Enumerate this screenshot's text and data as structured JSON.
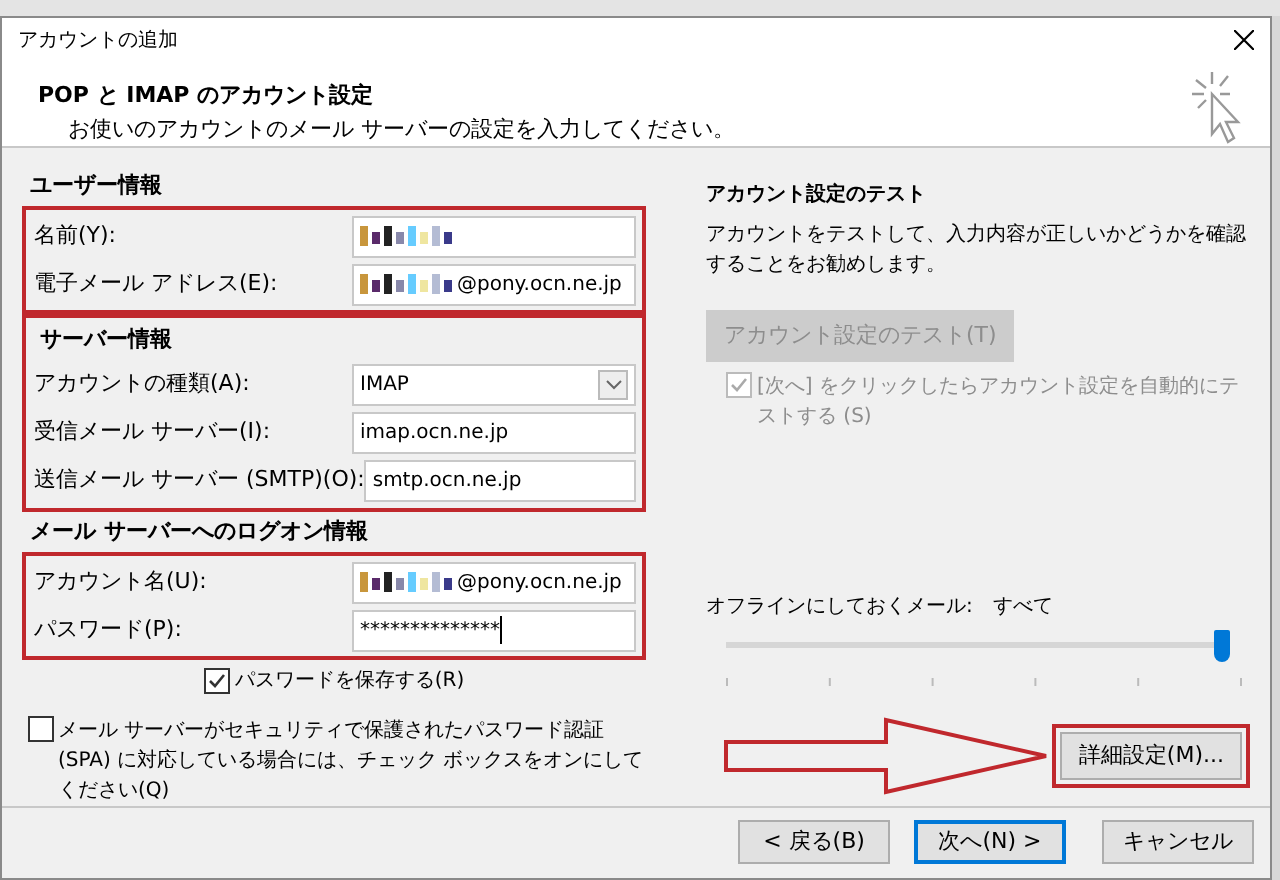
{
  "window": {
    "title": "アカウントの追加"
  },
  "header": {
    "title": "POP と IMAP のアカウント設定",
    "subtitle": "お使いのアカウントのメール サーバーの設定を入力してください。"
  },
  "sections": [
    {
      "heading": "ユーザー情報",
      "kind": "framed-fields",
      "fields": [
        {
          "label": "名前(Y):",
          "kind": "text",
          "redacted": true
        },
        {
          "label": "電子メール アドレス(E):",
          "kind": "text",
          "redacted": true,
          "value": "@pony.ocn.ne.jp"
        }
      ]
    },
    {
      "heading": "サーバー情報",
      "kind": "framed-section",
      "fields": [
        {
          "label": "アカウントの種類(A):",
          "kind": "select",
          "value": "IMAP"
        },
        {
          "label": "受信メール サーバー(I):",
          "kind": "text",
          "value": "imap.ocn.ne.jp"
        },
        {
          "label": "送信メール サーバー (SMTP)(O):",
          "kind": "text",
          "value": "smtp.ocn.ne.jp"
        }
      ]
    },
    {
      "heading": "メール サーバーへのログオン情報",
      "kind": "framed-fields",
      "fields": [
        {
          "label": "アカウント名(U):",
          "kind": "text",
          "redacted": true,
          "value": "@pony.ocn.ne.jp"
        },
        {
          "label": "パスワード(P):",
          "kind": "password",
          "value": "**************",
          "focused": true
        }
      ]
    }
  ],
  "save_password": {
    "label": "パスワードを保存する(R)",
    "checked": true
  },
  "spa": {
    "label": "メール サーバーがセキュリティで保護されたパスワード認証 (SPA) に対応している場合には、チェック ボックスをオンにしてください(Q)",
    "checked": false
  },
  "test": {
    "heading": "アカウント設定のテスト",
    "description": "アカウントをテストして、入力内容が正しいかどうかを確認することをお勧めします。",
    "button": {
      "label": "アカウント設定のテスト(T)",
      "disabled": true
    },
    "auto_test": {
      "label": "[次へ] をクリックしたらアカウント設定を自動的にテストする (S)",
      "checked": true,
      "disabled": true
    }
  },
  "offline": {
    "label": "オフラインにしておくメール:",
    "value": "すべて",
    "level": 1
  },
  "advanced_button": {
    "label": "詳細設定(M)...",
    "highlighted": true
  },
  "footer_buttons": [
    {
      "label": "< 戻る(B)",
      "default": false
    },
    {
      "label": "次へ(N) >",
      "default": true
    },
    {
      "label": "キャンセル",
      "default": false
    }
  ]
}
